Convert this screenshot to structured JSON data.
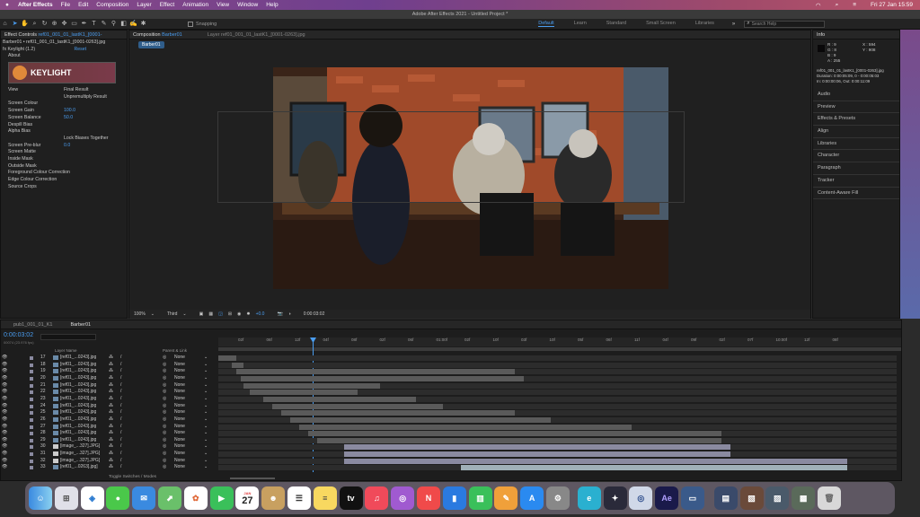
{
  "menubar": {
    "app": "After Effects",
    "items": [
      "File",
      "Edit",
      "Composition",
      "Layer",
      "Effect",
      "Animation",
      "View",
      "Window",
      "Help"
    ],
    "clock": "Fri 27 Jan  15:59"
  },
  "window_title": "Adobe After Effects 2021 - Untitled Project *",
  "toolbar": {
    "snapping": "Snapping",
    "workspaces": [
      "Default",
      "Learn",
      "Standard",
      "Small Screen",
      "Libraries"
    ],
    "active_workspace": "Default",
    "search_placeholder": "Search Help"
  },
  "effect_controls": {
    "tab": "Effect Controls",
    "tab_layer": "ref01_001_01_lastK1_[0001-",
    "header": "Barber01 • ref01_001_01_lastK1_[0001-0263].jpg",
    "fx": "Keylight (1.2)",
    "reset": "Reset",
    "about": "About",
    "logo": "KEYLIGHT",
    "rows": [
      {
        "label": "View",
        "value": "Final Result"
      },
      {
        "label": "",
        "value": "Unpremultiply Result"
      },
      {
        "label": "Screen Colour",
        "value": ""
      },
      {
        "label": "Screen Gain",
        "value": "100.0"
      },
      {
        "label": "Screen Balance",
        "value": "50.0"
      },
      {
        "label": "Despill Bias",
        "value": ""
      },
      {
        "label": "Alpha Bias",
        "value": ""
      },
      {
        "label": "",
        "value": "Lock Biases Together"
      },
      {
        "label": "Screen Pre-blur",
        "value": "0.0"
      },
      {
        "label": "Screen Matte",
        "value": ""
      },
      {
        "label": "Inside Mask",
        "value": ""
      },
      {
        "label": "Outside Mask",
        "value": ""
      },
      {
        "label": "Foreground Colour Correction",
        "value": ""
      },
      {
        "label": "Edge Colour Correction",
        "value": ""
      },
      {
        "label": "Source Crops",
        "value": ""
      }
    ]
  },
  "composition": {
    "tab": "Composition",
    "tab_name": "Barber01",
    "layer_tab": "Layer ref01_001_01_lastK1_[0001-0263].jpg",
    "chip": "Barber01",
    "zoom": "100%",
    "resolution": "Third",
    "exposure": "+0.0",
    "timecode": "0:00:03:02"
  },
  "info_panel": {
    "title": "Info",
    "r": "R : 9",
    "g": "G : 8",
    "b": "B : 9",
    "a": "A : 255",
    "x": "X : 594",
    "y": "Y : 908",
    "file": "ref01_001_01_lastK1_[0001-0263].jpg",
    "duration": "Duration: 0:00:05:09, 0 - 0:00:05:03",
    "inout": "In: 0:00:00:06, Out: 0:00:11:09"
  },
  "side_panels": [
    "Audio",
    "Preview",
    "Effects & Presets",
    "Align",
    "Libraries",
    "Character",
    "Paragraph",
    "Tracker",
    "Content-Aware Fill"
  ],
  "timeline": {
    "tabs": [
      "pub1_001_01_K1",
      "Barber01"
    ],
    "timecode": "0:00:03:02",
    "fps": "00074 (23.976 fps)",
    "columns": {
      "layer_name": "Layer Name",
      "parent": "Parent & Link"
    },
    "ticks": [
      "02f",
      "06f",
      "12f",
      "04f",
      "08f",
      "02f",
      "06f",
      "01:00f",
      "02f",
      "10f",
      "03f",
      "10f",
      "05f",
      "06f",
      "11f",
      "04f",
      "09f",
      "02f",
      "07f",
      "10:00f",
      "12f",
      "08f"
    ],
    "layers": [
      {
        "num": "17",
        "name": "[ref01_...0243].jpg",
        "parent": "None"
      },
      {
        "num": "18",
        "name": "[ref01_...0243].jpg",
        "parent": "None"
      },
      {
        "num": "19",
        "name": "[ref01_...0243].jpg",
        "parent": "None"
      },
      {
        "num": "20",
        "name": "[ref01_...0243].jpg",
        "parent": "None"
      },
      {
        "num": "21",
        "name": "[ref01_...0243].jpg",
        "parent": "None"
      },
      {
        "num": "22",
        "name": "[ref01_...0243].jpg",
        "parent": "None"
      },
      {
        "num": "23",
        "name": "[ref01_...0243].jpg",
        "parent": "None"
      },
      {
        "num": "24",
        "name": "[ref01_...0243].jpg",
        "parent": "None"
      },
      {
        "num": "25",
        "name": "[ref01_...0243].jpg",
        "parent": "None"
      },
      {
        "num": "26",
        "name": "[ref01_...0243].jpg",
        "parent": "None"
      },
      {
        "num": "27",
        "name": "[ref01_...0243].jpg",
        "parent": "None"
      },
      {
        "num": "28",
        "name": "[ref01_...0243].jpg",
        "parent": "None"
      },
      {
        "num": "29",
        "name": "[ref01_...0243].jpg",
        "parent": "None"
      },
      {
        "num": "30",
        "name": "[image_...327].JPG]",
        "parent": "None"
      },
      {
        "num": "31",
        "name": "[image_...327].JPG]",
        "parent": "None"
      },
      {
        "num": "32",
        "name": "[image_...327].JPG]",
        "parent": "None"
      },
      {
        "num": "33",
        "name": "[ref01_...0263].jpg]",
        "parent": "None"
      }
    ],
    "toggle": "Toggle Switches / Modes"
  },
  "dock": {
    "calendar_month": "JAN",
    "calendar_day": "27"
  },
  "colors": {
    "accent": "#4a9df0",
    "panel": "#1f1f1f",
    "timeline_bar": "#5a5a5a",
    "selected_bar": "#8a8aa0"
  }
}
